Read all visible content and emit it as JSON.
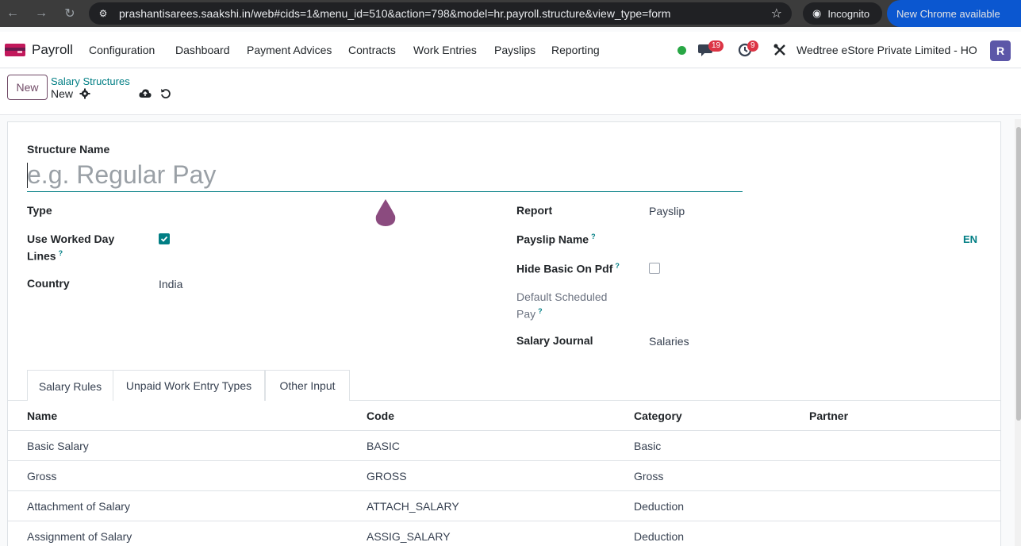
{
  "browser": {
    "url": "prashantisarees.saakshi.in/web#cids=1&menu_id=510&action=798&model=hr.payroll.structure&view_type=form",
    "incognito_label": "Incognito",
    "update_label": "New Chrome available"
  },
  "topnav": {
    "app_name": "Payroll",
    "menu": [
      "Configuration",
      "Dashboard",
      "Payment Advices",
      "Contracts",
      "Work Entries",
      "Payslips",
      "Reporting"
    ],
    "messages_count": "19",
    "activities_count": "9",
    "company": "Wedtree eStore Private Limited - HO",
    "avatar_letter": "R"
  },
  "control_panel": {
    "new_label": "New",
    "breadcrumb_parent": "Salary Structures",
    "breadcrumb_current": "New"
  },
  "form": {
    "structure_name_label": "Structure Name",
    "structure_name_placeholder": "e.g. Regular Pay",
    "type_label": "Type",
    "use_worked_day_label_1": "Use Worked Day",
    "use_worked_day_label_2": "Lines",
    "use_worked_day_checked": true,
    "country_label": "Country",
    "country_value": "India",
    "report_label": "Report",
    "report_value": "Payslip",
    "payslip_name_label": "Payslip Name",
    "lang_code": "EN",
    "hide_basic_label": "Hide Basic On Pdf",
    "hide_basic_checked": false,
    "default_pay_label_1": "Default Scheduled",
    "default_pay_label_2": "Pay",
    "salary_journal_label": "Salary Journal",
    "salary_journal_value": "Salaries",
    "help_mark": "?"
  },
  "tabs": [
    "Salary Rules",
    "Unpaid Work Entry Types",
    "Other Input"
  ],
  "table": {
    "headers": [
      "Name",
      "Code",
      "Category",
      "Partner"
    ],
    "rows": [
      [
        "Basic Salary",
        "BASIC",
        "Basic",
        ""
      ],
      [
        "Gross",
        "GROSS",
        "Gross",
        ""
      ],
      [
        "Attachment of Salary",
        "ATTACH_SALARY",
        "Deduction",
        ""
      ],
      [
        "Assignment of Salary",
        "ASSIG_SALARY",
        "Deduction",
        ""
      ]
    ]
  },
  "colors": {
    "brand": "#714b67",
    "accent": "#017e84"
  }
}
